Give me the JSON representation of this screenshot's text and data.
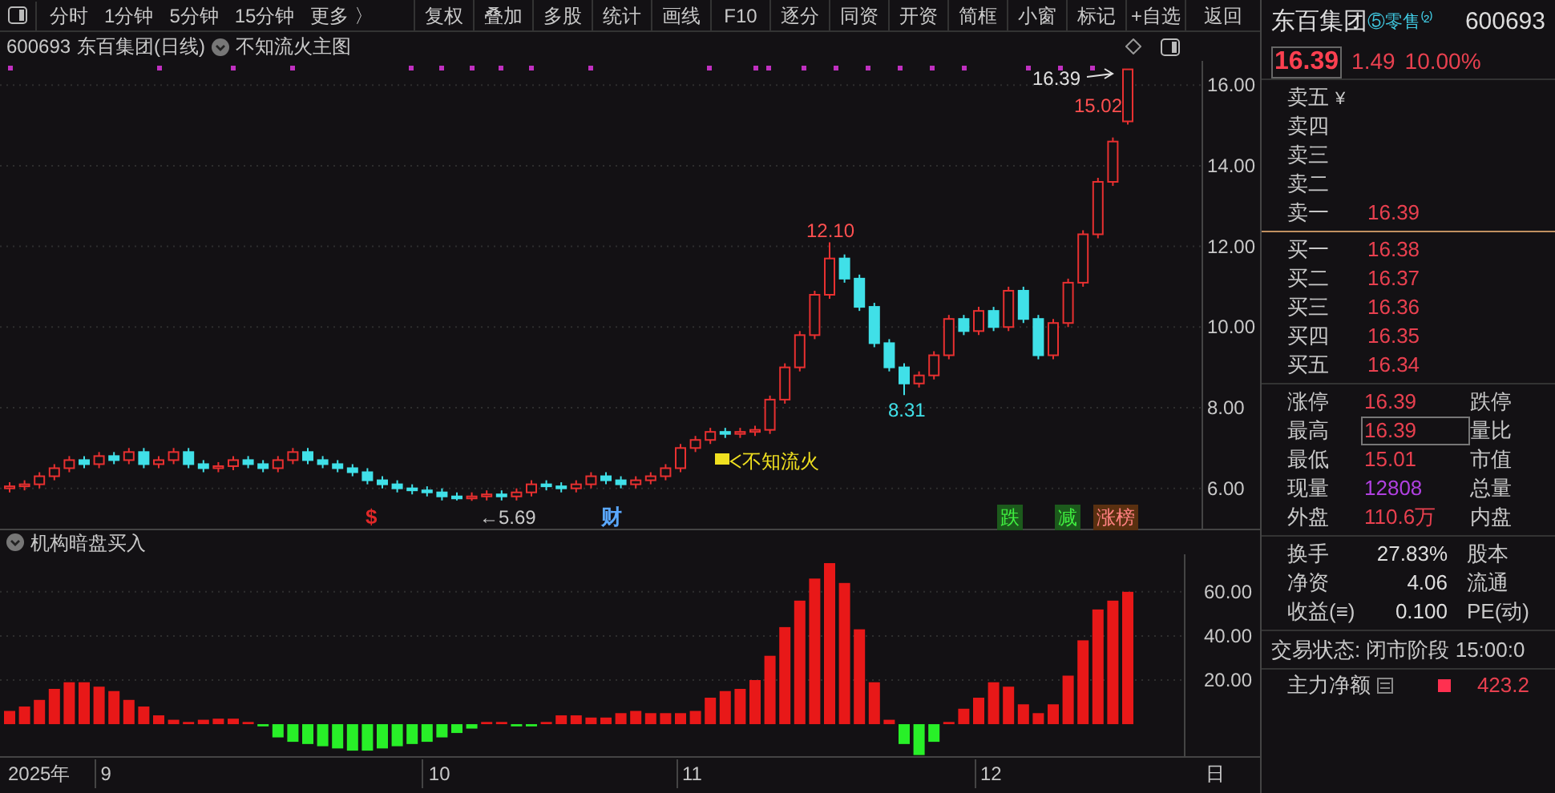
{
  "toolbar": {
    "period_tabs": [
      "分时",
      "1分钟",
      "5分钟",
      "15分钟",
      "更多 〉"
    ],
    "buttons": [
      "复权",
      "叠加",
      "多股",
      "统计",
      "画线",
      "F10",
      "逐分",
      "同资",
      "开资",
      "简框",
      "小窗",
      "标记",
      "+自选",
      "返回"
    ]
  },
  "chart_header": {
    "code": "600693",
    "name": "东百集团(日线)",
    "indicator": "不知流火主图"
  },
  "main_chart": {
    "high_label": "12.10",
    "low_label": "8.31",
    "min_label": "←5.69",
    "last_label": "16.39",
    "last_low_label": "15.02",
    "signal_label": "不知流火",
    "markers": [
      {
        "text": "$",
        "kind": "plain",
        "color": "#e02828"
      },
      {
        "text": "财",
        "kind": "plain",
        "color": "#5aa8ff"
      },
      {
        "text": "跌",
        "kind": "tag",
        "color": "#1c5a1c"
      },
      {
        "text": "减",
        "kind": "tag",
        "color": "#1c5a1c"
      },
      {
        "text": "涨榜",
        "kind": "tag",
        "color": "#5a3010"
      }
    ],
    "chart_data": {
      "type": "candlestick",
      "ylim": [
        5,
        16.6
      ],
      "grid": true,
      "yticks": [
        {
          "value": 16,
          "label": "16.00"
        },
        {
          "value": 14,
          "label": "14.00"
        },
        {
          "value": 12,
          "label": "12.00"
        },
        {
          "value": 10,
          "label": "10.00"
        },
        {
          "value": 8,
          "label": "8.00"
        },
        {
          "value": 6,
          "label": "6.00"
        }
      ],
      "ohlc": [
        [
          6.0,
          6.15,
          5.9,
          6.05
        ],
        [
          6.05,
          6.2,
          5.95,
          6.1
        ],
        [
          6.1,
          6.4,
          6.0,
          6.3
        ],
        [
          6.3,
          6.6,
          6.2,
          6.5
        ],
        [
          6.5,
          6.8,
          6.4,
          6.7
        ],
        [
          6.7,
          6.8,
          6.5,
          6.6
        ],
        [
          6.6,
          6.9,
          6.5,
          6.8
        ],
        [
          6.8,
          6.9,
          6.6,
          6.7
        ],
        [
          6.7,
          7.0,
          6.6,
          6.9
        ],
        [
          6.9,
          7.0,
          6.5,
          6.6
        ],
        [
          6.6,
          6.8,
          6.5,
          6.7
        ],
        [
          6.7,
          7.0,
          6.6,
          6.9
        ],
        [
          6.9,
          7.0,
          6.5,
          6.6
        ],
        [
          6.6,
          6.7,
          6.4,
          6.5
        ],
        [
          6.5,
          6.65,
          6.4,
          6.55
        ],
        [
          6.55,
          6.8,
          6.45,
          6.7
        ],
        [
          6.7,
          6.8,
          6.5,
          6.6
        ],
        [
          6.6,
          6.7,
          6.4,
          6.5
        ],
        [
          6.5,
          6.8,
          6.4,
          6.7
        ],
        [
          6.7,
          7.0,
          6.6,
          6.9
        ],
        [
          6.9,
          7.0,
          6.6,
          6.7
        ],
        [
          6.7,
          6.8,
          6.5,
          6.6
        ],
        [
          6.6,
          6.7,
          6.4,
          6.5
        ],
        [
          6.5,
          6.6,
          6.3,
          6.4
        ],
        [
          6.4,
          6.5,
          6.1,
          6.2
        ],
        [
          6.2,
          6.3,
          6.0,
          6.1
        ],
        [
          6.1,
          6.2,
          5.9,
          6.0
        ],
        [
          6.0,
          6.1,
          5.85,
          5.95
        ],
        [
          5.95,
          6.05,
          5.8,
          5.9
        ],
        [
          5.9,
          6.0,
          5.7,
          5.8
        ],
        [
          5.8,
          5.9,
          5.7,
          5.75
        ],
        [
          5.75,
          5.9,
          5.69,
          5.8
        ],
        [
          5.8,
          5.95,
          5.7,
          5.85
        ],
        [
          5.85,
          5.95,
          5.7,
          5.8
        ],
        [
          5.8,
          6.0,
          5.7,
          5.9
        ],
        [
          5.9,
          6.2,
          5.8,
          6.1
        ],
        [
          6.1,
          6.2,
          5.95,
          6.05
        ],
        [
          6.05,
          6.15,
          5.9,
          6.0
        ],
        [
          6.0,
          6.2,
          5.9,
          6.1
        ],
        [
          6.1,
          6.4,
          6.0,
          6.3
        ],
        [
          6.3,
          6.4,
          6.1,
          6.2
        ],
        [
          6.2,
          6.3,
          6.0,
          6.1
        ],
        [
          6.1,
          6.3,
          6.0,
          6.2
        ],
        [
          6.2,
          6.4,
          6.1,
          6.3
        ],
        [
          6.3,
          6.6,
          6.2,
          6.5
        ],
        [
          6.5,
          7.1,
          6.4,
          7.0
        ],
        [
          7.0,
          7.3,
          6.9,
          7.2
        ],
        [
          7.2,
          7.5,
          7.1,
          7.4
        ],
        [
          7.4,
          7.5,
          7.25,
          7.35
        ],
        [
          7.35,
          7.5,
          7.25,
          7.4
        ],
        [
          7.4,
          7.55,
          7.3,
          7.45
        ],
        [
          7.45,
          8.3,
          7.35,
          8.2
        ],
        [
          8.2,
          9.1,
          8.1,
          9.0
        ],
        [
          9.0,
          9.9,
          8.9,
          9.8
        ],
        [
          9.8,
          10.9,
          9.7,
          10.8
        ],
        [
          10.8,
          12.1,
          10.7,
          11.7
        ],
        [
          11.7,
          11.8,
          11.1,
          11.2
        ],
        [
          11.2,
          11.3,
          10.4,
          10.5
        ],
        [
          10.5,
          10.6,
          9.5,
          9.6
        ],
        [
          9.6,
          9.7,
          8.9,
          9.0
        ],
        [
          9.0,
          9.1,
          8.31,
          8.6
        ],
        [
          8.6,
          8.9,
          8.5,
          8.8
        ],
        [
          8.8,
          9.4,
          8.7,
          9.3
        ],
        [
          9.3,
          10.3,
          9.2,
          10.2
        ],
        [
          10.2,
          10.3,
          9.8,
          9.9
        ],
        [
          9.9,
          10.5,
          9.8,
          10.4
        ],
        [
          10.4,
          10.5,
          9.9,
          10.0
        ],
        [
          10.0,
          11.0,
          9.9,
          10.9
        ],
        [
          10.9,
          11.0,
          10.1,
          10.2
        ],
        [
          10.2,
          10.3,
          9.2,
          9.3
        ],
        [
          9.3,
          10.2,
          9.2,
          10.1
        ],
        [
          10.1,
          11.2,
          10.0,
          11.1
        ],
        [
          11.1,
          12.4,
          11.0,
          12.3
        ],
        [
          12.3,
          13.7,
          12.2,
          13.6
        ],
        [
          13.6,
          14.7,
          13.5,
          14.6
        ],
        [
          15.1,
          16.39,
          15.02,
          16.39
        ]
      ]
    }
  },
  "sub_chart": {
    "title": "机构暗盘买入",
    "year_label": "2025年",
    "month_labels": [
      "9",
      "10",
      "11",
      "12"
    ],
    "end_label": "日",
    "chart_data": {
      "type": "bar",
      "ylim": [
        -14.5,
        77
      ],
      "grid": true,
      "yticks": [
        {
          "value": 20,
          "label": "20.00"
        },
        {
          "value": 40,
          "label": "40.00"
        },
        {
          "value": 60,
          "label": "60.00"
        }
      ],
      "values": [
        6,
        8,
        11,
        16,
        19,
        19,
        17,
        15,
        11,
        8,
        4,
        2,
        1,
        2,
        2.5,
        2.5,
        1,
        -1,
        -6,
        -8,
        -9,
        -10,
        -11,
        -12,
        -12,
        -11,
        -10,
        -9,
        -8,
        -6,
        -4,
        -2,
        1,
        1,
        -1,
        -1,
        1,
        4,
        4,
        3,
        3,
        5,
        6,
        5,
        5,
        5,
        6,
        12,
        15,
        16,
        20,
        31,
        44,
        56,
        66,
        73,
        64,
        43,
        19,
        2,
        -9,
        -14,
        -8,
        1,
        7,
        12,
        19,
        17,
        9,
        5,
        9,
        22,
        38,
        52,
        56,
        60
      ]
    }
  },
  "quote": {
    "name": "东百集团",
    "tag": "⑤零售⁽²⁾",
    "code": "600693",
    "price": "16.39",
    "change": "1.49",
    "change_pct": "10.00%",
    "asks": [
      {
        "label": "卖五",
        "note": "¥"
      },
      {
        "label": "卖四"
      },
      {
        "label": "卖三"
      },
      {
        "label": "卖二"
      },
      {
        "label": "卖一",
        "price": "16.39"
      }
    ],
    "bids": [
      {
        "label": "买一",
        "price": "16.38"
      },
      {
        "label": "买二",
        "price": "16.37"
      },
      {
        "label": "买三",
        "price": "16.36"
      },
      {
        "label": "买四",
        "price": "16.35"
      },
      {
        "label": "买五",
        "price": "16.34"
      }
    ],
    "stats": [
      {
        "label": "涨停",
        "value": "16.39",
        "color": "#e8404f",
        "boxed": false,
        "label2": "跌停"
      },
      {
        "label": "最高",
        "value": "16.39",
        "color": "#e8404f",
        "boxed": true,
        "label2": "量比"
      },
      {
        "label": "最低",
        "value": "15.01",
        "color": "#e8404f",
        "boxed": false,
        "label2": "市值"
      },
      {
        "label": "现量",
        "value": "12808",
        "color": "#b040e0",
        "boxed": false,
        "label2": "总量"
      },
      {
        "label": "外盘",
        "value": "110.6万",
        "color": "#e8404f",
        "boxed": false,
        "label2": "内盘"
      }
    ],
    "fundamentals": [
      {
        "label": "换手",
        "value": "27.83%",
        "label2": "股本"
      },
      {
        "label": "净资",
        "value": "4.06",
        "label2": "流通"
      },
      {
        "label": "收益(≡)",
        "value": "0.100",
        "label2": "PE(动)"
      }
    ],
    "trade_status": "交易状态: 闭市阶段 15:00:0",
    "net_flow_label": "主力净额",
    "net_flow_value": "423.2"
  }
}
